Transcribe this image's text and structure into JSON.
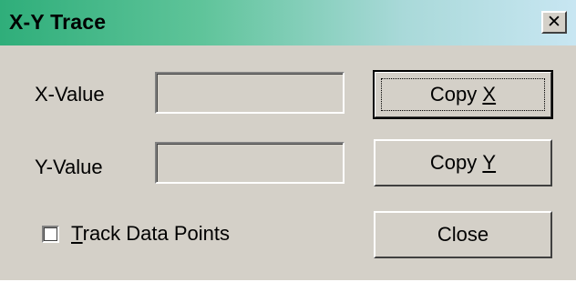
{
  "window": {
    "title": "X-Y Trace",
    "close_glyph": "✕"
  },
  "form": {
    "x_label": "X-Value",
    "x_value": "",
    "y_label": "Y-Value",
    "y_value": "",
    "track_label_access": "T",
    "track_label_rest": "rack Data Points",
    "track_checked": false
  },
  "buttons": {
    "copy_x_prefix": "Copy",
    "copy_x_access": "X",
    "copy_y_prefix": "Copy",
    "copy_y_access": "Y",
    "close_label": "Close"
  }
}
